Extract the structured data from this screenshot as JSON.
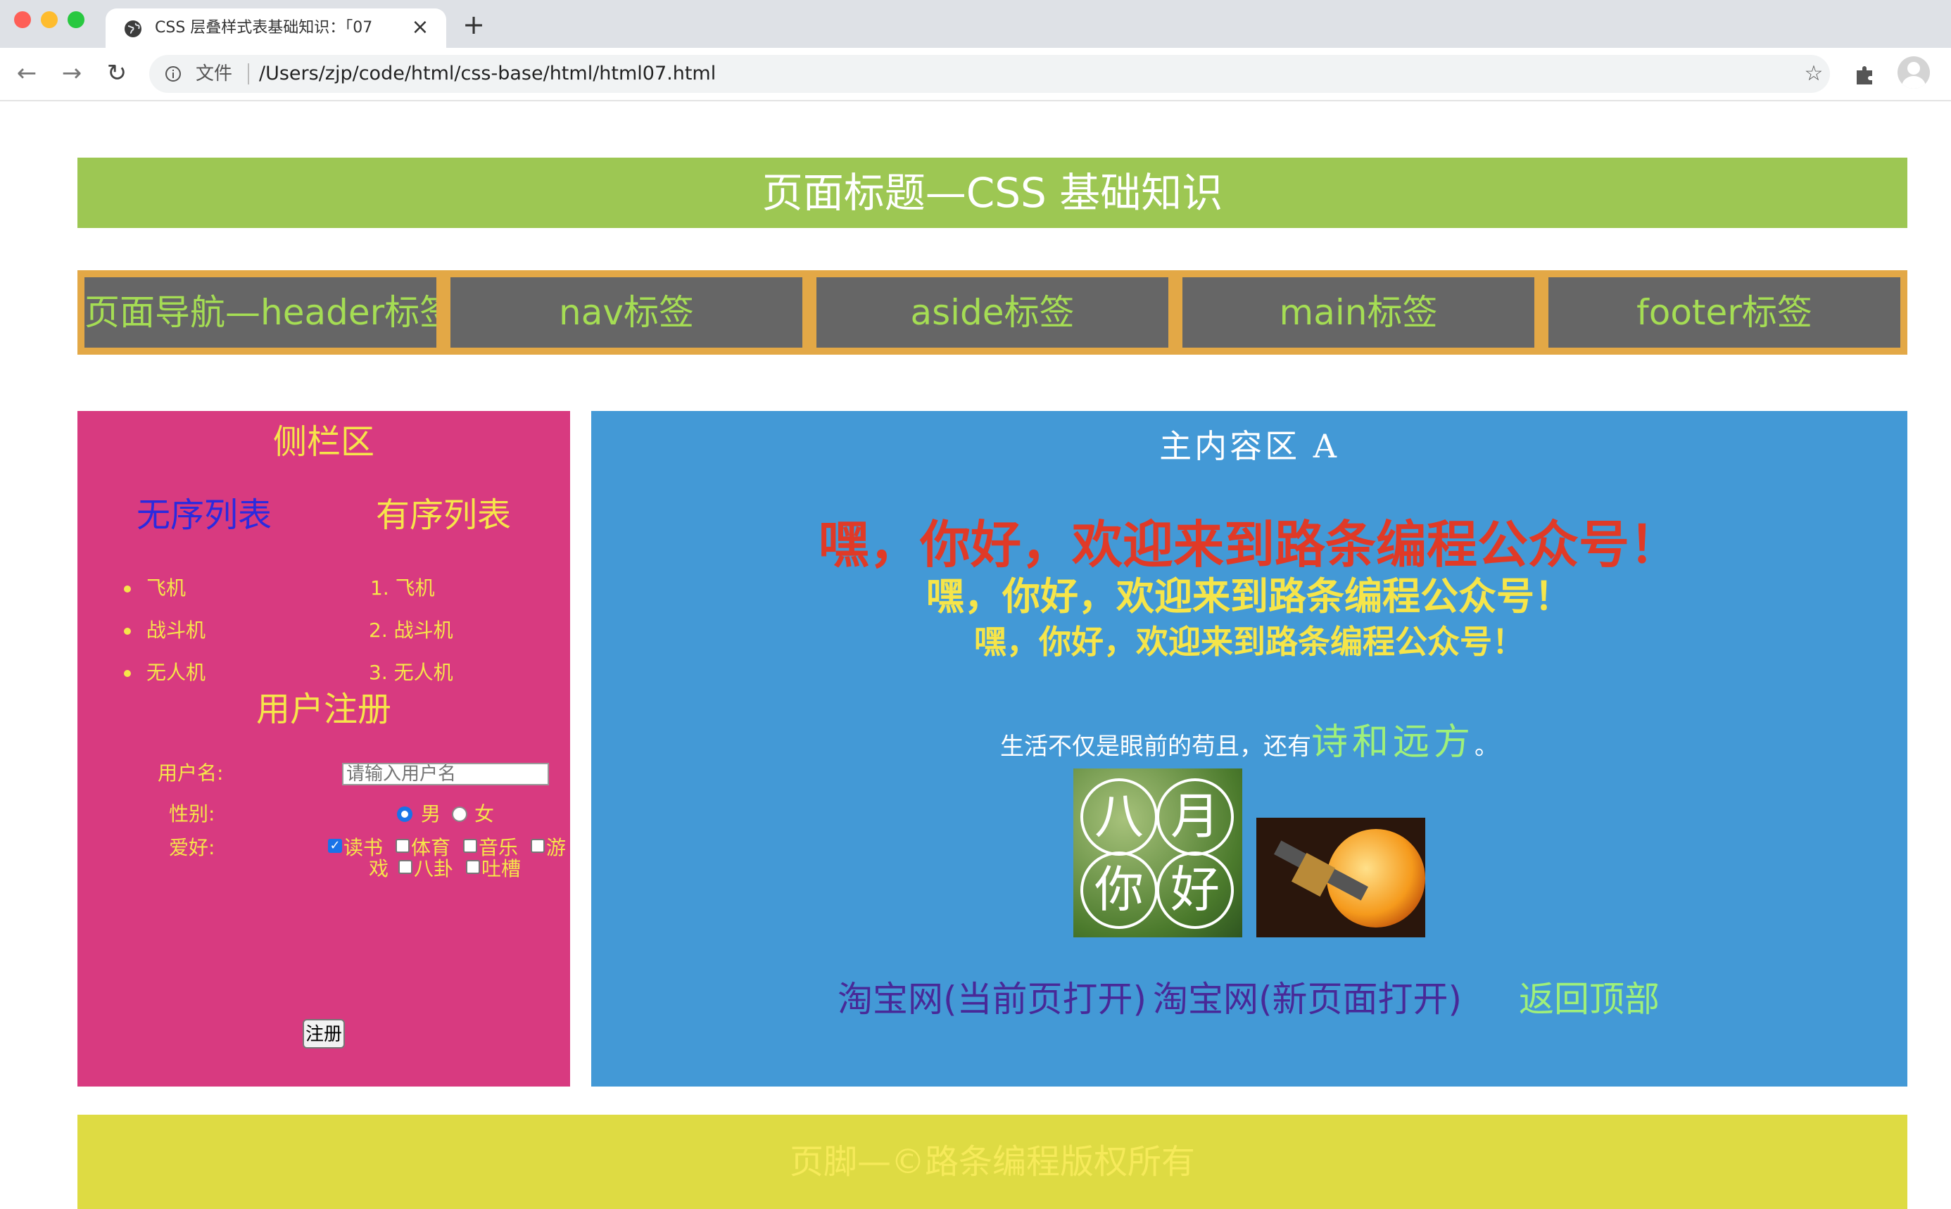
{
  "browser": {
    "tab_title": "CSS 层叠样式表基础知识：「07",
    "file_label": "文件",
    "url": "/Users/zjp/code/html/css-base/html/html07.html",
    "icons": [
      "globe-icon",
      "close-icon",
      "plus-icon",
      "back-icon",
      "forward-icon",
      "reload-icon",
      "info-icon",
      "star-icon",
      "puzzle-icon",
      "avatar-icon"
    ]
  },
  "header": {
    "title": "页面标题—CSS 基础知识"
  },
  "nav": {
    "items": [
      "页面导航—header标签",
      "nav标签",
      "aside标签",
      "main标签",
      "footer标签"
    ]
  },
  "aside": {
    "title": "侧栏区",
    "ul_title": "无序列表",
    "ol_title": "有序列表",
    "ul_items": [
      "飞机",
      "战斗机",
      "无人机"
    ],
    "ol_items": [
      "1. 飞机",
      "2. 战斗机",
      "3. 无人机"
    ],
    "register_title": "用户注册",
    "username_label": "用户名:",
    "username_placeholder": "请输入用户名",
    "gender_label": "性别:",
    "gender_options": [
      "男",
      "女"
    ],
    "hobby_label": "爱好:",
    "hobbies": [
      "读书",
      "体育",
      "音乐",
      "游",
      "戏",
      "八卦",
      "吐槽"
    ],
    "submit_label": "注册"
  },
  "main": {
    "title": "主内容区 A",
    "greeting": "嘿，你好，欢迎来到路条编程公众号！",
    "quote_plain": "生活不仅是眼前的苟且，还有",
    "quote_fancy": "诗和远方",
    "quote_end": "。",
    "image_aug_chars": [
      "八",
      "月",
      "你",
      "好"
    ],
    "link_current": "淘宝网(当前页打开)",
    "link_new": "淘宝网(新页面打开)",
    "link_top": "返回顶部"
  },
  "footer": {
    "text": "页脚—©路条编程版权所有"
  },
  "colors": {
    "header_bg": "#9dc753",
    "nav_bg": "#e3a846",
    "nav_item_bg": "#666666",
    "nav_text": "#a5dd54",
    "aside_bg": "#d83a80",
    "main_bg": "#4399d6",
    "footer_bg": "#dedb43",
    "greeting_red": "#e03a27",
    "greeting_yellow": "#f6e54a",
    "link_purple": "#482998",
    "link_green": "#9ff07a"
  }
}
